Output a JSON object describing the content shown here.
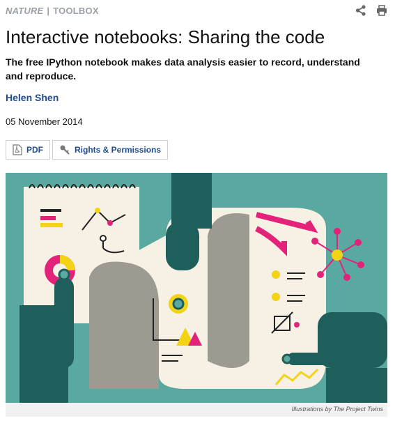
{
  "header": {
    "brand": "NATURE",
    "separator": "|",
    "section": "TOOLBOX"
  },
  "header_icons": [
    "share-icon",
    "print-icon"
  ],
  "article": {
    "title": "Interactive notebooks: Sharing the code",
    "subtitle": "The free IPython notebook makes data analysis easier to record, understand and reproduce.",
    "author": "Helen Shen",
    "date": "05 November 2014"
  },
  "actions": {
    "pdf_label": "PDF",
    "rights_label": "Rights & Permissions"
  },
  "figure": {
    "credit": "Illustrations by The Project Twins"
  },
  "colors": {
    "link": "#1f4b8f",
    "teal": "#5aa9a0",
    "dark_teal": "#1e5f5c",
    "magenta": "#e3237a",
    "yellow": "#f3d316"
  }
}
